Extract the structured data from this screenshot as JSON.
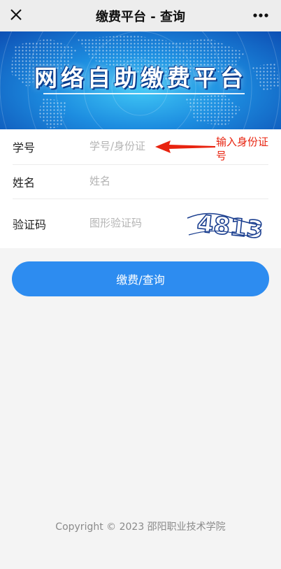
{
  "navbar": {
    "title": "缴费平台 - 查询",
    "close_icon": "close-icon",
    "more_icon": "more-dots-icon"
  },
  "banner": {
    "title": "网络自助缴费平台",
    "background_icon": "world-map-illustration"
  },
  "form": {
    "student_id": {
      "label": "学号",
      "placeholder": "学号/身份证",
      "value": ""
    },
    "name": {
      "label": "姓名",
      "placeholder": "姓名",
      "value": ""
    },
    "captcha": {
      "label": "验证码",
      "placeholder": "图形验证码",
      "value": "",
      "image_text": "4813"
    }
  },
  "annotation": {
    "text": "输入身份证号",
    "color": "#e8230f"
  },
  "submit": {
    "label": "缴费/查询",
    "color": "#2d8cf0"
  },
  "footer": {
    "text": "Copyright © 2023  邵阳职业技术学院"
  }
}
